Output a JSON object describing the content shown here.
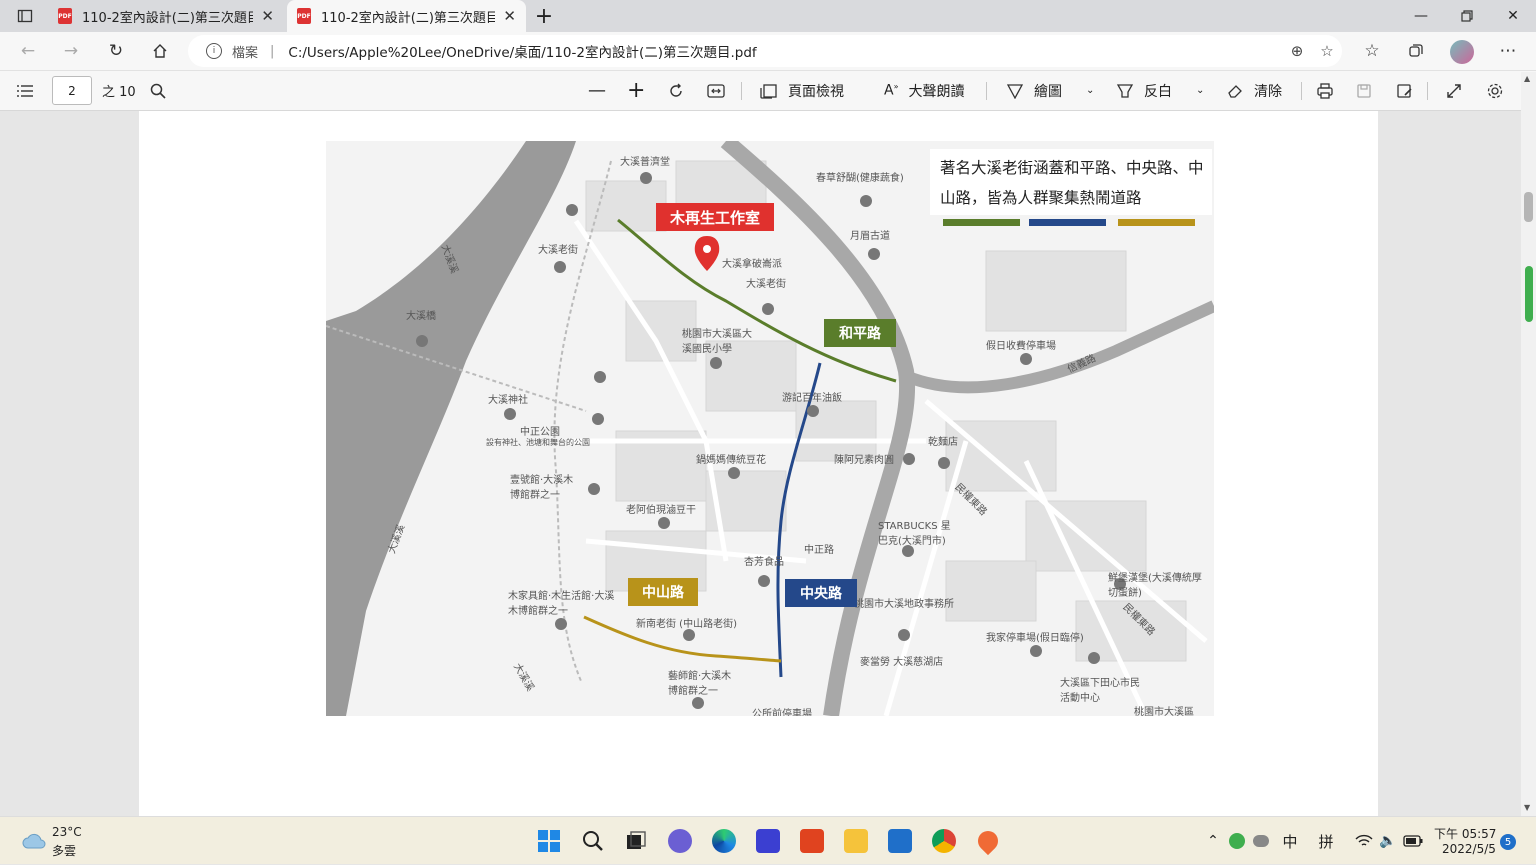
{
  "tabs": [
    {
      "title": "110-2室內設計(二)第三次題目.pc",
      "icon": "pdf-icon",
      "active": false
    },
    {
      "title": "110-2室內設計(二)第三次題目.pc",
      "icon": "pdf-icon",
      "active": true
    }
  ],
  "address": {
    "scheme_label": "檔案",
    "separator": "|",
    "url": "C:/Users/Apple%20Lee/OneDrive/桌面/110-2室內設計(二)第三次題目.pdf"
  },
  "pdf_toolbar": {
    "page_current": "2",
    "page_total": "之 10",
    "page_view_label": "頁面檢視",
    "read_aloud_label": "大聲朗讀",
    "draw_label": "繪圖",
    "highlight_label": "反白",
    "erase_label": "清除"
  },
  "map": {
    "note": "著名大溪老街涵蓋和平路、中央路、中山路，皆為人群聚集熱鬧道路",
    "poi_main": "木再生工作室",
    "tag_heping": "和平路",
    "tag_zhongyang": "中央路",
    "tag_zhongshan": "中山路",
    "colors": {
      "heping": "#5a7d2b",
      "zhongyang": "#24488a",
      "zhongshan": "#b8931a",
      "poi": "#e0312e"
    },
    "labels": {
      "l1": "大溪普濟堂",
      "l2": "春草舒醐(健康蔬食)",
      "l3": "月眉古道",
      "l4": "大溪老街",
      "l5": "大溪拿破崙派",
      "l6": "大溪老街",
      "l7": "大溪橋",
      "l8": "大溪溪",
      "l9": "桃園市大溪區大溪國民小學",
      "l10": "大溪神社",
      "l11": "中正公園",
      "l12": "設有神社、池塘和舞台的公園",
      "l13": "壹號館·大溪木博館群之一",
      "l14": "假日收費停車場",
      "l15": "信義路",
      "l16": "游記百年油飯",
      "l17": "乾麵店",
      "l18": "鍋媽媽傳統豆花",
      "l19": "陳阿兄素肉圓",
      "l20": "老阿伯現滷豆干",
      "l21": "STARBUCKS 星巴克(大溪門市)",
      "l22": "中正路",
      "l23": "杏芳食品",
      "l24": "木家具館·木生活館·大溪木博館群之一",
      "l25": "新南老街 (中山路老街)",
      "l26": "桃園市大溪地政事務所",
      "l27": "鮮堡漢堡(大溪傳統厚切蛋餅)",
      "l28": "我家停車場(假日臨停)",
      "l29": "麥當勞 大溪慈湖店",
      "l30": "藝師館·大溪木博館群之一",
      "l31": "大溪區下田心市民活動中心",
      "l32": "公所前停車場",
      "l33": "桃園市大溪區",
      "l34": "大溪溪",
      "l35": "大溪溪",
      "l36": "民權東路",
      "l37": "民權東路"
    }
  },
  "taskbar": {
    "weather_temp": "23°C",
    "weather_desc": "多雲",
    "ime_lang": "中",
    "ime_mode": "拼",
    "time": "下午 05:57",
    "date": "2022/5/5",
    "notif_count": "5"
  }
}
